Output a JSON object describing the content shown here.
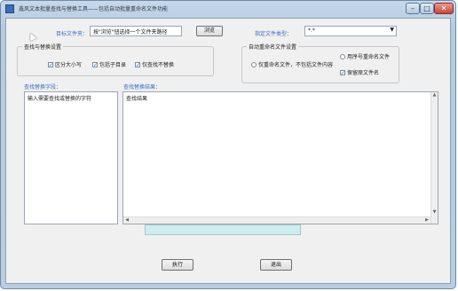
{
  "window": {
    "title": "鑫风文本批量查找与替换工具——包括自动批量重命名文件功能",
    "minimize_label": "–",
    "maximize_label": "□",
    "close_label": "✕"
  },
  "dir_row": {
    "label": "目标文件夹：",
    "path_value": "按\"浏览\"钮选择一个文件夹路径",
    "browse_label": "浏览"
  },
  "file_type": {
    "label": "指定文件类型：",
    "selected": "*.*"
  },
  "search_settings": {
    "title": "查找与替换设置",
    "options": [
      {
        "label": "区分大小写",
        "checked": true
      },
      {
        "label": "包括子目录",
        "checked": true
      },
      {
        "label": "仅查找不替换",
        "checked": true
      }
    ]
  },
  "rename_settings": {
    "title": "自动重命名文件设置",
    "options": [
      {
        "kind": "radio",
        "label": "仅重命名文件，不包括文件内容",
        "checked": false
      },
      {
        "kind": "radio",
        "label": "用序号重命名文件",
        "checked": false
      },
      {
        "kind": "checkbox",
        "label": "保留原文件名",
        "checked": true
      }
    ]
  },
  "left_panel": {
    "label": "查找替换字段：",
    "content": "输入需要查找或替换的字符"
  },
  "right_panel": {
    "label": "查找替换结果：",
    "content": "查找结果"
  },
  "progress": {
    "value": 0
  },
  "actions": {
    "execute_label": "执行",
    "exit_label": "退出"
  },
  "colors": {
    "label_blue": "#3a70c6",
    "progress_fill": "#cdeeee"
  }
}
